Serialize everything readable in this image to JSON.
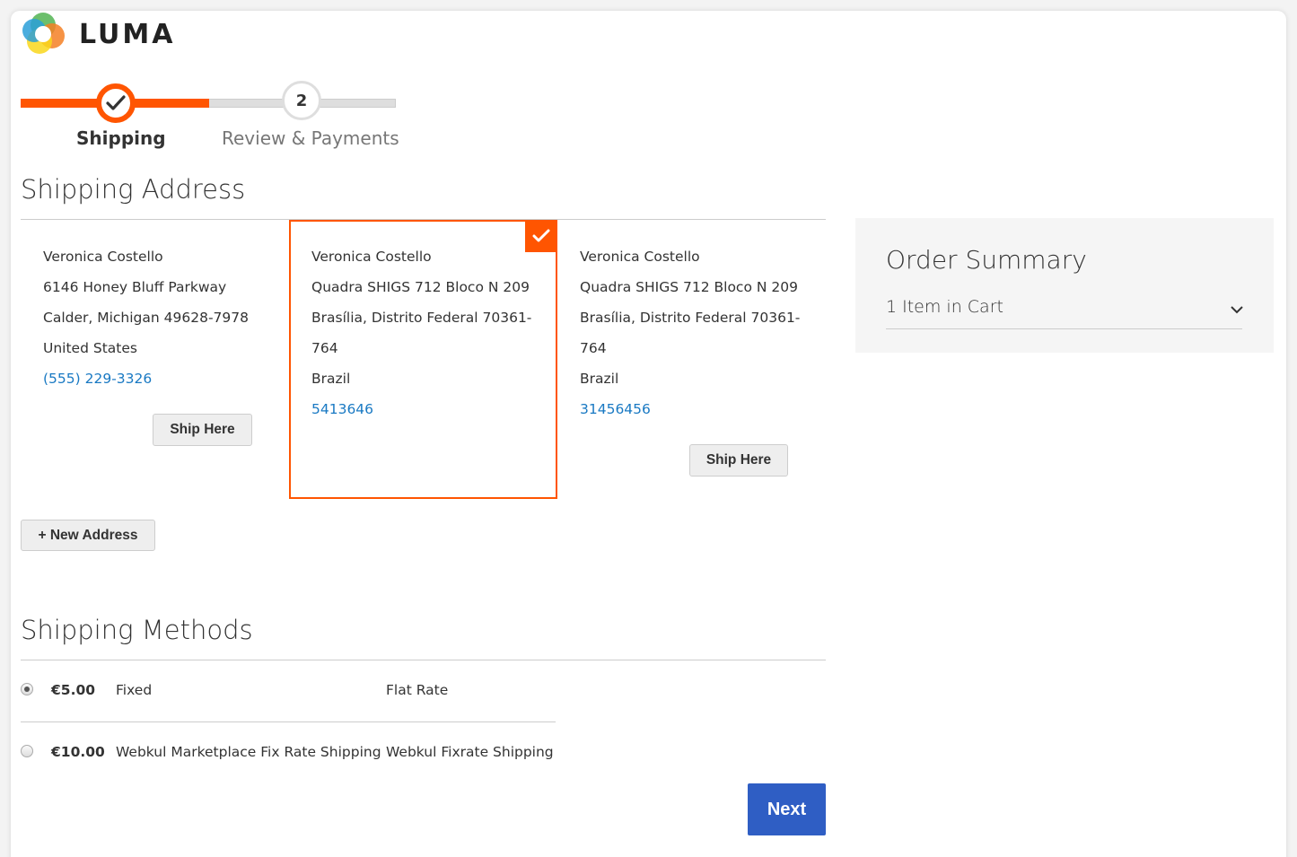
{
  "brand": {
    "name": "LUMA"
  },
  "progress": {
    "steps": [
      {
        "label": "Shipping",
        "number": "1",
        "state": "complete"
      },
      {
        "label": "Review & Payments",
        "number": "2",
        "state": "pending"
      }
    ]
  },
  "shipping_address": {
    "title": "Shipping Address",
    "addresses": [
      {
        "name": "Veronica Costello",
        "street": "6146 Honey Bluff Parkway",
        "city": "Calder, Michigan 49628-7978",
        "city_cont": "",
        "country": "United States",
        "phone": "(555) 229-3326",
        "button": "Ship Here",
        "selected": false
      },
      {
        "name": "Veronica Costello",
        "street": "Quadra SHIGS 712 Bloco N 209",
        "city": "Brasília, Distrito Federal 70361-",
        "city_cont": "764",
        "country": "Brazil",
        "phone": "5413646",
        "button": "",
        "selected": true
      },
      {
        "name": "Veronica Costello",
        "street": "Quadra SHIGS 712 Bloco N 209",
        "city": "Brasília, Distrito Federal 70361-",
        "city_cont": "764",
        "country": "Brazil",
        "phone": "31456456",
        "button": "Ship Here",
        "selected": false
      }
    ],
    "new_address_button": "+ New Address"
  },
  "order_summary": {
    "title": "Order Summary",
    "items_label": "1 Item in Cart"
  },
  "shipping_methods": {
    "title": "Shipping Methods",
    "methods": [
      {
        "price": "€5.00",
        "method": "Fixed",
        "carrier": "Flat Rate",
        "selected": true
      },
      {
        "price": "€10.00",
        "method": "Webkul Marketplace Fix Rate Shipping",
        "carrier": "Webkul Fixrate Shipping",
        "selected": false
      }
    ],
    "next_button": "Next"
  },
  "colors": {
    "accent": "#ff5501",
    "link": "#1979c3",
    "primary_button": "#2f5ec4"
  }
}
